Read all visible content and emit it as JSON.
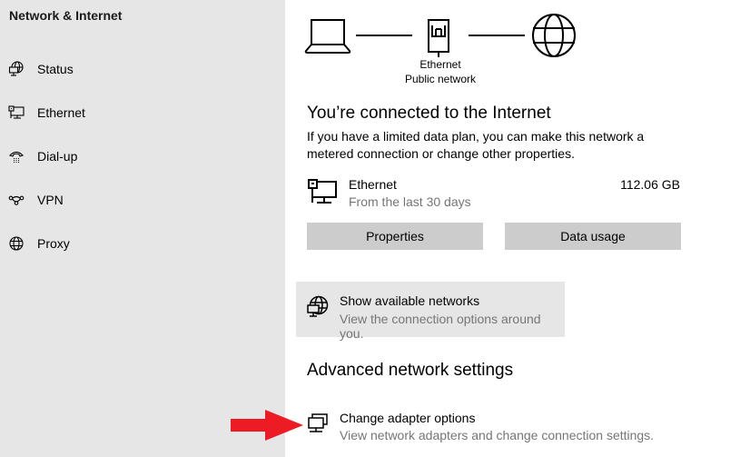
{
  "sidebar": {
    "title": "Network & Internet",
    "items": [
      {
        "label": "Status",
        "icon": "network-status-icon"
      },
      {
        "label": "Ethernet",
        "icon": "ethernet-icon"
      },
      {
        "label": "Dial-up",
        "icon": "dialup-phone-icon"
      },
      {
        "label": "VPN",
        "icon": "vpn-icon"
      },
      {
        "label": "Proxy",
        "icon": "globe-icon"
      }
    ]
  },
  "diagram": {
    "adapter_name": "Ethernet",
    "network_type": "Public network"
  },
  "status": {
    "heading": "You’re connected to the Internet",
    "description": "If you have a limited data plan, you can make this network a metered connection or change other properties."
  },
  "connection": {
    "name": "Ethernet",
    "period": "From the last 30 days",
    "usage": "112.06 GB"
  },
  "buttons": {
    "properties": "Properties",
    "data_usage": "Data usage"
  },
  "show_networks": {
    "title": "Show available networks",
    "subtitle": "View the connection options around you."
  },
  "advanced": {
    "heading": "Advanced network settings",
    "change_adapter": {
      "title": "Change adapter options",
      "subtitle": "View network adapters and change connection settings."
    }
  },
  "annotation": {
    "arrow_color": "#ed1c24"
  }
}
